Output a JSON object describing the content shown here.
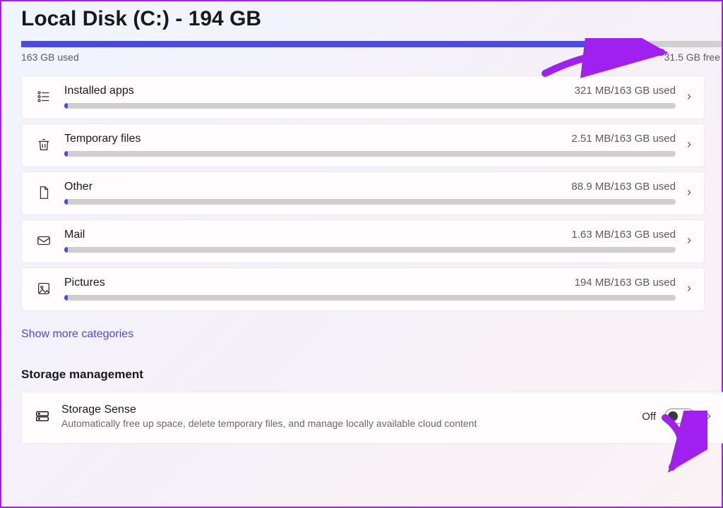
{
  "header": {
    "title": "Local Disk (C:) - 194 GB",
    "used_label": "163 GB used",
    "free_label": "31.5 GB free",
    "used_fraction": 0.838
  },
  "categories": [
    {
      "icon": "installed-apps",
      "label": "Installed apps",
      "usage": "321 MB/163 GB used",
      "fraction": 0.002
    },
    {
      "icon": "trash",
      "label": "Temporary files",
      "usage": "2.51 MB/163 GB used",
      "fraction": 0.0001
    },
    {
      "icon": "file",
      "label": "Other",
      "usage": "88.9 MB/163 GB used",
      "fraction": 0.0005
    },
    {
      "icon": "mail",
      "label": "Mail",
      "usage": "1.63 MB/163 GB used",
      "fraction": 0.0001
    },
    {
      "icon": "image",
      "label": "Pictures",
      "usage": "194 MB/163 GB used",
      "fraction": 0.001
    }
  ],
  "show_more_label": "Show more categories",
  "storage_management": {
    "header": "Storage management",
    "sense": {
      "title": "Storage Sense",
      "description": "Automatically free up space, delete temporary files, and manage locally available cloud content",
      "state_label": "Off",
      "on": false
    }
  }
}
